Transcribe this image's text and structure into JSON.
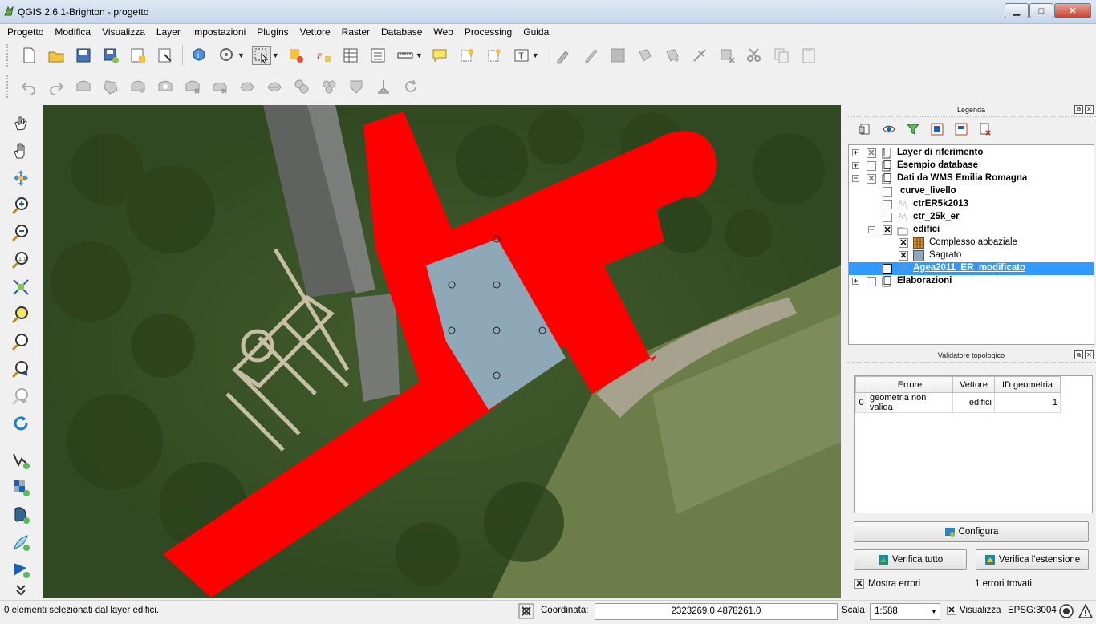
{
  "window": {
    "title": "QGIS 2.6.1-Brighton - progetto",
    "minimize": "▁",
    "maximize": "□",
    "close": "✕"
  },
  "menu": [
    "Progetto",
    "Modifica",
    "Visualizza",
    "Layer",
    "Impostazioni",
    "Plugins",
    "Vettore",
    "Raster",
    "Database",
    "Web",
    "Processing",
    "Guida"
  ],
  "toolbar1": {
    "icons": [
      "new-project",
      "open-project",
      "save-project",
      "save-as",
      "new-print-composer",
      "composer-manager",
      "identify",
      "pan-to-selection",
      "select-features",
      "deselect",
      "expression",
      "attribute-table",
      "statistics",
      "measure",
      "map-tips",
      "new-bookmark",
      "show-bookmarks",
      "text-annotation",
      "current-edits",
      "toggle-editing",
      "save-edits",
      "add-feature",
      "move-feature",
      "node-tool",
      "delete-selected",
      "cut-features",
      "copy-features",
      "paste-features"
    ]
  },
  "toolbar2": {
    "icons": [
      "undo",
      "redo",
      "simplify",
      "add-ring",
      "add-part",
      "fill-ring",
      "delete-ring",
      "delete-part",
      "reshape",
      "offset-curve",
      "split-features",
      "split-parts",
      "merge-selected",
      "merge-attributes",
      "rotate-symbols"
    ]
  },
  "left_toolbar": {
    "icons": [
      "pan-map-icon",
      "hand-icon",
      "pan-to-selection-icon",
      "zoom-in-icon",
      "zoom-out-icon",
      "zoom-native-icon",
      "zoom-full-icon",
      "zoom-selection-icon",
      "zoom-layer-icon",
      "zoom-last-icon",
      "zoom-next-icon",
      "refresh-icon",
      "add-vector-icon",
      "add-raster-icon",
      "add-postgis-icon",
      "add-spatialite-icon",
      "add-wms-icon",
      "more-icon"
    ]
  },
  "legend": {
    "title": "Legenda",
    "layers": [
      {
        "label": "Layer di riferimento",
        "bold": true,
        "checked": "mixed",
        "expander": "+",
        "indent": 0,
        "icon": "group"
      },
      {
        "label": "Esempio database",
        "bold": true,
        "checked": "none",
        "expander": "+",
        "indent": 0,
        "icon": "group"
      },
      {
        "label": "Dati da WMS Emilia Romagna",
        "bold": true,
        "checked": "mixed",
        "expander": "−",
        "indent": 0,
        "icon": "group"
      },
      {
        "label": "curve_livello",
        "bold": true,
        "checked": "none",
        "expander": "",
        "indent": 1,
        "icon": "none"
      },
      {
        "label": "ctrER5k2013",
        "bold": true,
        "checked": "none",
        "expander": "",
        "indent": 1,
        "icon": "raster"
      },
      {
        "label": "ctr_25k_er",
        "bold": true,
        "checked": "none",
        "expander": "",
        "indent": 1,
        "icon": "raster"
      },
      {
        "label": "edifici",
        "bold": true,
        "checked": "checked",
        "expander": "−",
        "indent": 1,
        "icon": "folder"
      },
      {
        "label": "Complesso abbaziale",
        "bold": false,
        "checked": "checked",
        "expander": "",
        "indent": 2,
        "icon": "pattern"
      },
      {
        "label": "Sagrato",
        "bold": false,
        "checked": "checked",
        "expander": "",
        "indent": 2,
        "icon": "bluefill"
      },
      {
        "label": "Agea2011_ER_modificato",
        "bold": true,
        "checked": "checked",
        "expander": "",
        "indent": 1,
        "icon": "raster",
        "selected": true
      },
      {
        "label": "Elaborazioni",
        "bold": true,
        "checked": "none",
        "expander": "+",
        "indent": 0,
        "icon": "group"
      }
    ]
  },
  "validator": {
    "title": "Validatore topologico",
    "columns": [
      "Errore",
      "Vettore",
      "ID geometria"
    ],
    "rows": [
      {
        "index": "0",
        "errore": "geometria non valida",
        "vettore": "edifici",
        "id": "1"
      }
    ],
    "configure_label": "Configura",
    "verify_all_label": "Verifica tutto",
    "verify_extent_label": "Verifica l'estensione",
    "show_errors_label": "Mostra errori",
    "errors_found": "1 errori trovati"
  },
  "status": {
    "message": "0 elementi selezionati dal layer edifici.",
    "coord_label": "Coordinata:",
    "coord_value": "2323269.0,4878261.0",
    "scale_label": "Scala",
    "scale_value": "1:588",
    "render_label": "Visualizza",
    "crs": "EPSG:3004"
  },
  "colors": {
    "red_polygon": "#ff0000",
    "blue_polygon": "#8fa8b8",
    "selection": "#3399ff"
  }
}
